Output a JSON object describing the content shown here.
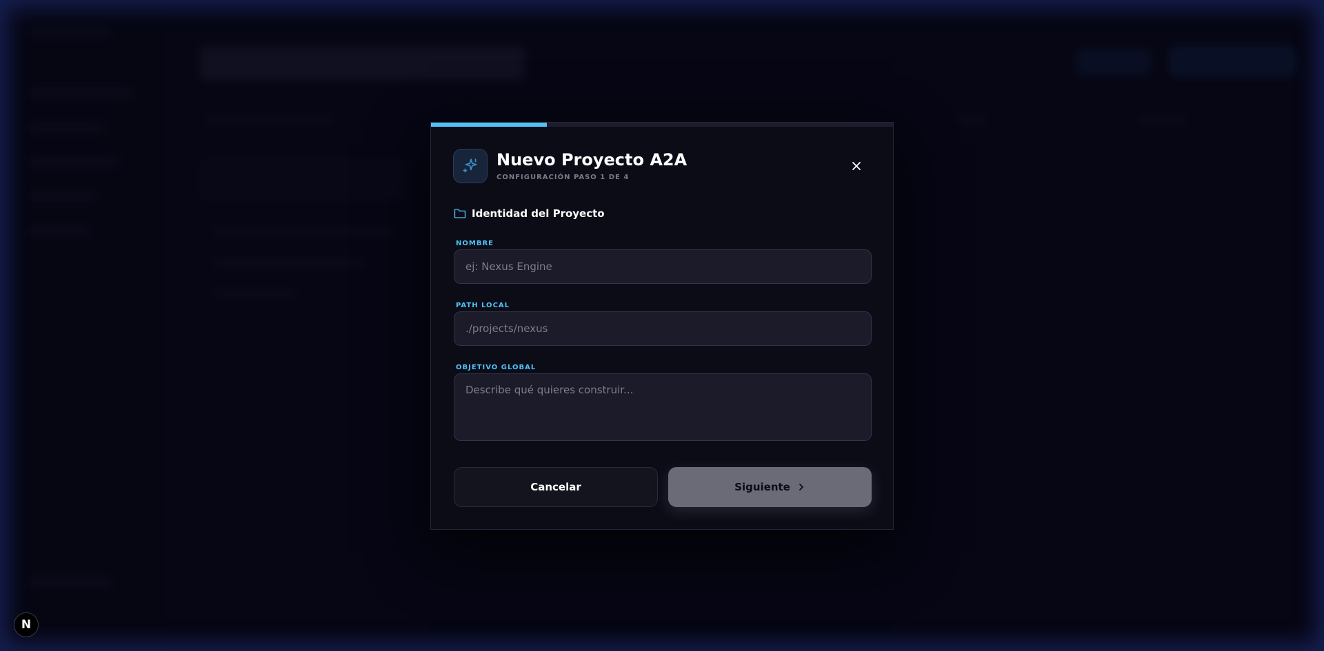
{
  "modal": {
    "progress": 0.25,
    "title": "Nuevo Proyecto A2A",
    "subtitle": "CONFIGURACIÓN PASO 1 DE 4",
    "section_title": "Identidad del Proyecto",
    "fields": {
      "name": {
        "label": "NOMBRE",
        "placeholder": "ej: Nexus Engine",
        "value": ""
      },
      "path": {
        "label": "PATH LOCAL",
        "placeholder": "./projects/nexus",
        "value": ""
      },
      "goal": {
        "label": "OBJETIVO GLOBAL",
        "placeholder": "Describe qué quieres construir...",
        "value": ""
      }
    },
    "cancel_label": "Cancelar",
    "next_label": "Siguiente"
  },
  "devtools_badge": "N",
  "colors": {
    "accent": "#4fc3f7",
    "modal_bg": "#0c0c17",
    "next_button_bg": "#6b6b78"
  },
  "icons": {
    "header": "sparkles-icon",
    "close": "close-icon",
    "section": "folder-icon",
    "next": "chevron-right-icon"
  }
}
